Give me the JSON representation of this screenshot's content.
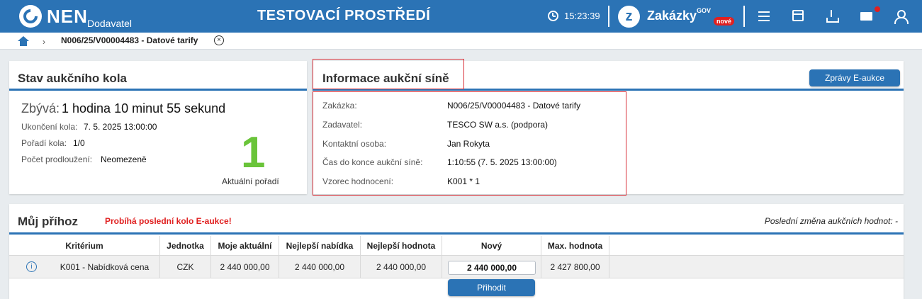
{
  "header": {
    "logo": "NEN",
    "logo_sub": "Dodavatel",
    "environment": "TESTOVACÍ PROSTŘEDÍ",
    "clock": "15:23:39",
    "zakazky_icon_letter": "z",
    "zakazky": "Zakázky",
    "zakazky_gov": "GOV",
    "zakazky_badge": "nové",
    "icons": [
      "clock-icon",
      "menu-icon",
      "calendar-icon",
      "download-icon",
      "mail-icon",
      "user-icon"
    ]
  },
  "breadcrumb": {
    "current": "N006/25/V00004483 - Datové tarify",
    "close_glyph": "×"
  },
  "round": {
    "title": "Stav aukčního kola",
    "remaining_label": "Zbývá:",
    "remaining_value": "1 hodina 10 minut 55 sekund",
    "end_label": "Ukončení kola:",
    "end_value": "7. 5. 2025 13:00:00",
    "order_label": "Pořadí kola:",
    "order_value": "1/0",
    "ext_label": "Počet prodloužení:",
    "ext_value": "Neomezeně",
    "rank": "1",
    "rank_caption": "Aktuální pořadí"
  },
  "info": {
    "title": "Informace aukční síně",
    "messages_button": "Zprávy E-aukce",
    "rows": [
      {
        "label": "Zakázka:",
        "value": "N006/25/V00004483 - Datové tarify"
      },
      {
        "label": "Zadavatel:",
        "value": "TESCO SW a.s. (podpora)"
      },
      {
        "label": "Kontaktní osoba:",
        "value": "Jan Rokyta"
      },
      {
        "label": "Čas do konce aukční síně:",
        "value": "1:10:55 (7. 5. 2025 13:00:00)"
      },
      {
        "label": "Vzorec hodnocení:",
        "value": "K001 * 1"
      }
    ]
  },
  "bid": {
    "title": "Můj příhoz",
    "warning": "Probíhá poslední kolo E-aukce!",
    "last_change": "Poslední změna aukčních hodnot: -",
    "columns": [
      "Kritérium",
      "Jednotka",
      "Moje aktuální",
      "Nejlepší nabídka",
      "Nejlepší hodnota",
      "Nový",
      "Max. hodnota"
    ],
    "row": {
      "criterion": "K001 - Nabídková cena",
      "unit": "CZK",
      "my_current": "2 440 000,00",
      "best_offer": "2 440 000,00",
      "best_value": "2 440 000,00",
      "new_value": "2 440 000,00",
      "max_value": "2 427 800,00"
    },
    "submit_button": "Přihodit"
  },
  "colors": {
    "brand": "#2b73b5",
    "warning": "#e02020",
    "rank": "#6ac43a",
    "highlight": "#d9323a"
  }
}
